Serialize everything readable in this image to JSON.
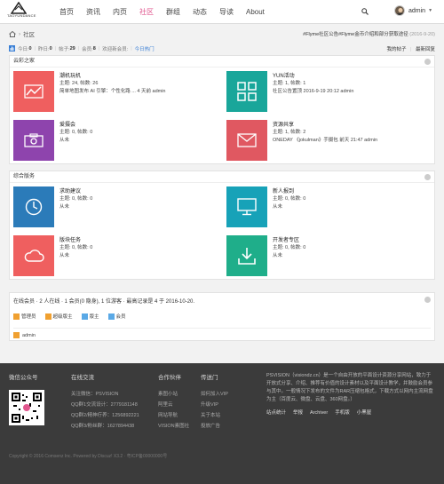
{
  "nav": {
    "logo_text": "TAOYUNDANCE",
    "items": [
      "首页",
      "资讯",
      "内页",
      "社区",
      "群组",
      "动态",
      "导读",
      "About"
    ],
    "active_index": 3,
    "user": "admin"
  },
  "crumb": {
    "home_icon": "home-icon",
    "current": "社区"
  },
  "notice": {
    "text": "#Flyme社区公告#Flyme金币介绍和部分获取途径",
    "date": "(2016-9-20)"
  },
  "stats": {
    "today_label": "今日:",
    "today": "0",
    "yesterday_label": "昨日:",
    "yesterday": "0",
    "posts_label": "帖子:",
    "posts": "29",
    "members_label": "会员:",
    "members": "8",
    "welcome": "欢迎新会员:",
    "hot": "今日热门",
    "my_posts": "我的帖子",
    "latest": "最新回复"
  },
  "section1": {
    "title": "云彩之家",
    "forums": [
      {
        "name": "潮机玩机",
        "topics": "主题: 24, 帖数: 26",
        "last": "简单地图发布 AI 引擎：个性化路 ... 4 天前 admin",
        "color": "#ef5f5f",
        "icon": "chart-icon"
      },
      {
        "name": "YUN活动",
        "topics": "主题: 1, 帖数: 1",
        "last": "社区公告置顶 2016-9-19 20:12 admin",
        "color": "#19a69a",
        "icon": "grid-icon"
      },
      {
        "name": "爱摄会",
        "topics": "主题: 0, 帖数: 0",
        "last": "从未",
        "color": "#8e44ad",
        "icon": "camera-icon"
      },
      {
        "name": "资源共享",
        "topics": "主题: 1, 帖数: 2",
        "last": "ONEDAY 《jokulman》手摄包 前天 21:47 admin",
        "color": "#e05861",
        "icon": "mail-icon"
      }
    ]
  },
  "section2": {
    "title": "综合版务",
    "forums": [
      {
        "name": "求助建议",
        "topics": "主题: 0, 帖数: 0",
        "last": "从未",
        "color": "#2b7bb9",
        "icon": "clock-icon"
      },
      {
        "name": "新人报到",
        "topics": "主题: 0, 帖数: 0",
        "last": "从未",
        "color": "#17a2b8",
        "icon": "monitor-icon"
      },
      {
        "name": "版块任务",
        "topics": "主题: 0, 帖数: 0",
        "last": "从未",
        "color": "#ef5f5f",
        "icon": "cloud-icon"
      },
      {
        "name": "开发者专区",
        "topics": "主题: 0, 帖数: 0",
        "last": "从未",
        "color": "#1fae8a",
        "icon": "download-icon"
      }
    ]
  },
  "online": {
    "title": "在线会员 · 2 人在线 · 1 会员(0 隐身), 1 位游客 · 最高记录是 4 于 2016-10-20.",
    "legend": [
      {
        "label": "管理员",
        "color": "#f0a030"
      },
      {
        "label": "超级版主",
        "color": "#f0a030"
      },
      {
        "label": "版主",
        "color": "#5aa9e6"
      },
      {
        "label": "会员",
        "color": "#5aa9e6"
      }
    ],
    "admin": "admin"
  },
  "footer": {
    "wechat": "微信公众号",
    "exchange_title": "在线交流",
    "exchange": [
      "关注微信：PSVISION",
      "QQ群1交流设计：2779181148",
      "QQ群2/精神疗养：1256892221",
      "QQ群3/粉丝群：1627894438"
    ],
    "partners_title": "合作伙伴",
    "partners": [
      "素图小站",
      "阿里云",
      "网站导航",
      "VISION素图社"
    ],
    "portal_title": "传送门",
    "portal": [
      "如何加入VIP",
      "升级VIP",
      "关于本站",
      "投放广告"
    ],
    "about": "PSVISION（visiondz.cn）是一个自由开放的平面设计资源分享网站，致力于开放式分享、介绍、推荐有价值的设计素材以及平面设计教学，并鼓励会员参与其中。一般情况下发布的文件为RAR压缩包格式，下载方式以网内主流网盘为主（百度云、微盘、云盘、360网盘。）",
    "links": [
      "站点统计",
      "举报",
      "Archiver",
      "手机版",
      "小黑屋"
    ],
    "copyright": "Copyright © 2016 Comsenz Inc. Powered by Discuz! X3.2 · 粤ICP备00000000号"
  }
}
